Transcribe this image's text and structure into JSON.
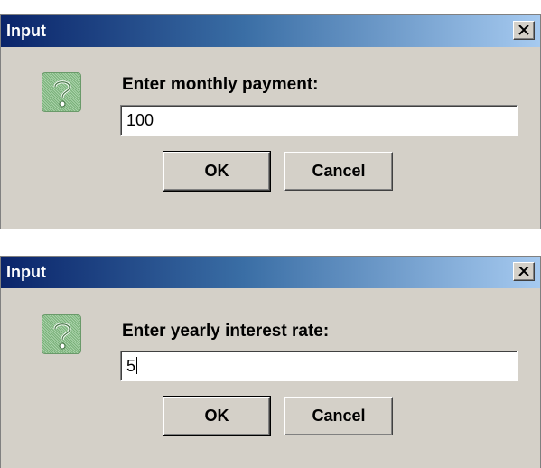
{
  "dialogs": [
    {
      "title": "Input",
      "prompt": "Enter monthly payment:",
      "value": "100",
      "ok_label": "OK",
      "cancel_label": "Cancel",
      "icon": "question-icon",
      "close_icon": "close-icon"
    },
    {
      "title": "Input",
      "prompt": "Enter yearly interest rate:",
      "value": "5",
      "ok_label": "OK",
      "cancel_label": "Cancel",
      "icon": "question-icon",
      "close_icon": "close-icon"
    }
  ],
  "colors": {
    "titlebar_start": "#0a246a",
    "titlebar_end": "#a6caf0",
    "dialog_bg": "#d4d0c8",
    "icon_green": "#7ab07a"
  }
}
